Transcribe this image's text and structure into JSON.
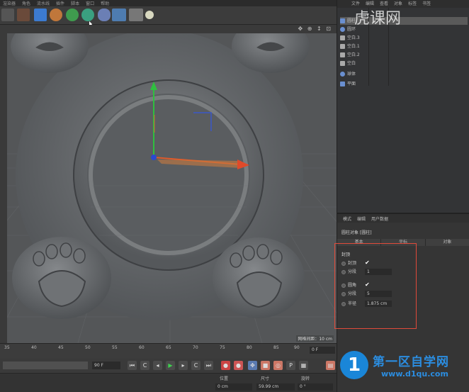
{
  "menubar": {
    "items": [
      "渲染器",
      "角色",
      "流水线",
      "插件",
      "脚本",
      "窗口",
      "帮助"
    ]
  },
  "toolbar": {
    "buttons": [
      "cube-icon",
      "pen-icon",
      "gear-green-icon",
      "gear-teal-icon",
      "capsule-icon",
      "grid-icon",
      "camera-icon",
      "light-icon"
    ]
  },
  "viewport": {
    "nav_icons": "✥ ⊕ ↕ ⊡",
    "scale_label": "网格间距：10 cm"
  },
  "timeline": {
    "ticks": [
      "35",
      "40",
      "45",
      "50",
      "55",
      "60",
      "65",
      "70",
      "75",
      "80",
      "85",
      "90"
    ],
    "frame": "0 F",
    "end_frame": "90 F"
  },
  "coords": {
    "position_header": "位置",
    "size_header": "尺寸",
    "rotation_header": "旋转",
    "position_value": "0 cm",
    "size_value": "59.99 cm",
    "rotation_value": "0 °"
  },
  "object_manager": {
    "menu": [
      "文件",
      "编辑",
      "查看",
      "对象",
      "标签",
      "书签"
    ],
    "objects": [
      {
        "name": "圆柱",
        "icon": "cylinder-icon"
      },
      {
        "name": "圆环",
        "icon": "torus-icon"
      },
      {
        "name": "空白.3",
        "icon": "null-icon"
      },
      {
        "name": "空白.1",
        "icon": "null-icon"
      },
      {
        "name": "空白.2",
        "icon": "null-icon"
      },
      {
        "name": "空白",
        "icon": "null-icon"
      },
      {
        "name": "球体",
        "icon": "sphere-icon"
      },
      {
        "name": "平面",
        "icon": "plane-icon"
      }
    ]
  },
  "attributes": {
    "menu": [
      "模式",
      "编辑",
      "用户数据"
    ],
    "title": "圆柱对象 [圆柱]",
    "tabs": [
      "基本",
      "坐标",
      "对象"
    ],
    "section": "封顶",
    "props": [
      {
        "label": "封顶",
        "value": "✔"
      },
      {
        "label": "分段",
        "value": "1"
      },
      {
        "label": "圆角",
        "value": "✔"
      },
      {
        "label": "分段",
        "value": "5"
      },
      {
        "label": "半径",
        "value": "1.875 cm"
      }
    ]
  },
  "watermark": {
    "top": "虎课网",
    "logo": "1",
    "name": "第一区自学网",
    "url": "www.d1qu.com"
  }
}
